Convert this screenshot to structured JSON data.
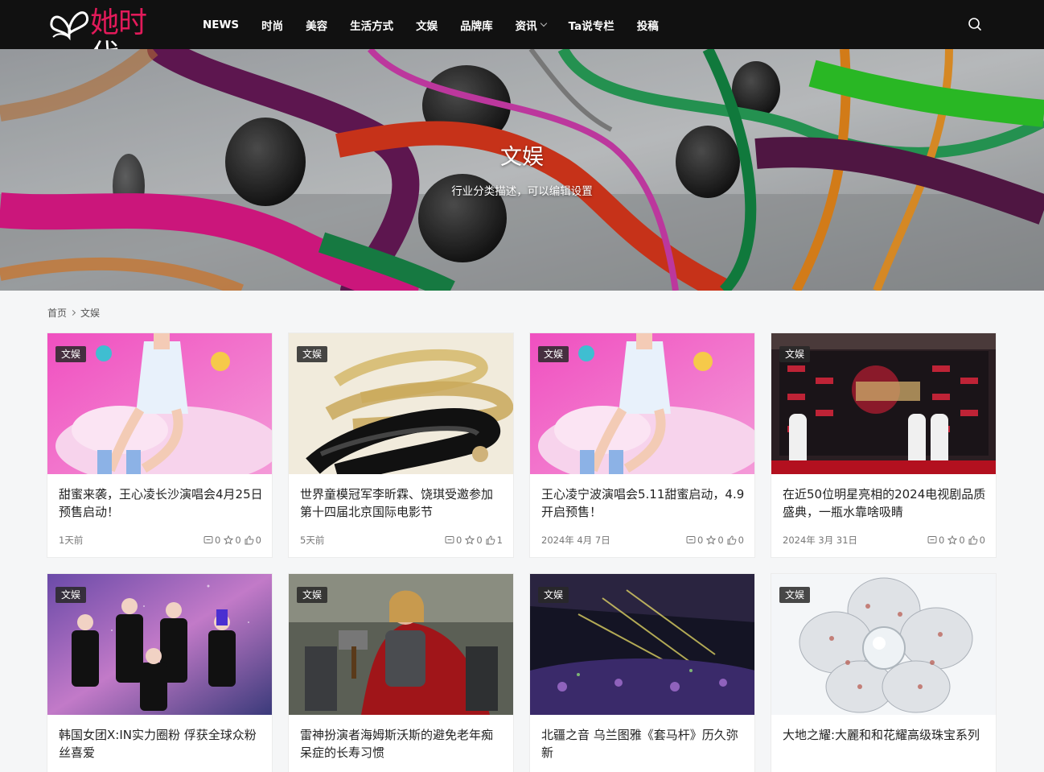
{
  "header": {
    "logo_chars": [
      "她",
      "时",
      "代"
    ],
    "nav": [
      {
        "label": "NEWS"
      },
      {
        "label": "时尚"
      },
      {
        "label": "美容"
      },
      {
        "label": "生活方式"
      },
      {
        "label": "文娱"
      },
      {
        "label": "品牌库"
      },
      {
        "label": "资讯"
      },
      {
        "label": "Ta说专栏"
      },
      {
        "label": "投稿"
      }
    ]
  },
  "banner": {
    "title": "文娱",
    "description": "行业分类描述，可以编辑设置"
  },
  "breadcrumb": {
    "home": "首页",
    "current": "文娱"
  },
  "cards": [
    {
      "tag": "文娱",
      "title": "甜蜜来袭，王心凌长沙演唱会4月25日预售启动！",
      "date": "1天前",
      "comments": "0",
      "favorites": "0",
      "likes": "0"
    },
    {
      "tag": "文娱",
      "title": "世界童模冠军李昕霖、饶琪受邀参加第十四届北京国际电影节",
      "date": "5天前",
      "comments": "0",
      "favorites": "0",
      "likes": "1"
    },
    {
      "tag": "文娱",
      "title": "王心凌宁波演唱会5.11甜蜜启动，4.9开启预售！",
      "date": "2024年 4月 7日",
      "comments": "0",
      "favorites": "0",
      "likes": "0"
    },
    {
      "tag": "文娱",
      "title": "在近50位明星亮相的2024电视剧品质盛典，一瓶水靠啥吸睛",
      "date": "2024年 3月 31日",
      "comments": "0",
      "favorites": "0",
      "likes": "0"
    },
    {
      "tag": "文娱",
      "title": "韩国女团X:IN实力圈粉 俘获全球众粉丝喜爱"
    },
    {
      "tag": "文娱",
      "title": "雷神扮演者海姆斯沃斯的避免老年痴呆症的长寿习惯"
    },
    {
      "tag": "文娱",
      "title": "北疆之音 乌兰图雅《套马杆》历久弥新"
    },
    {
      "tag": "文娱",
      "title": "大地之耀:大麗和和花耀高级珠宝系列"
    }
  ]
}
